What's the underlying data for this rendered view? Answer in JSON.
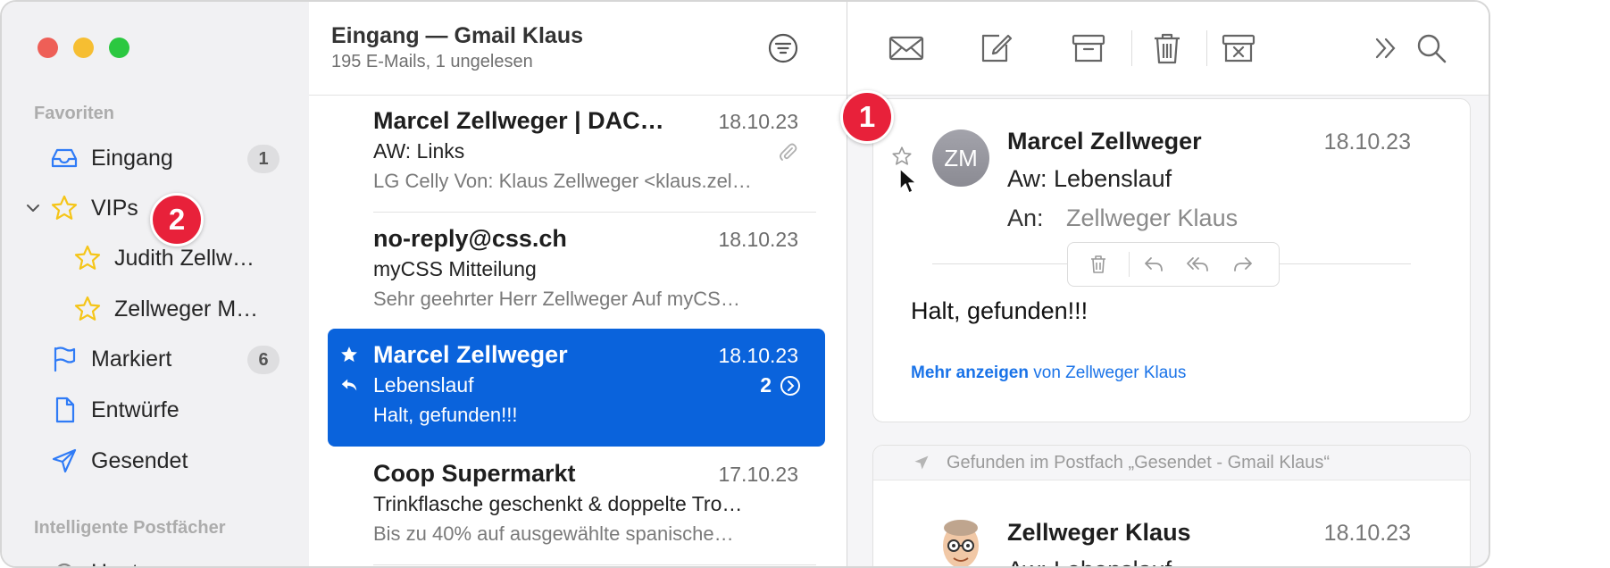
{
  "sidebar": {
    "sections": {
      "favorites": "Favoriten",
      "smart": "Intelligente Postfächer"
    },
    "items": [
      {
        "label": "Eingang",
        "count": "1",
        "icon": "tray-icon"
      },
      {
        "label": "VIPs",
        "icon": "star-icon"
      },
      {
        "label": "Judith Zellw…",
        "icon": "star-icon"
      },
      {
        "label": "Zellweger M…",
        "icon": "star-icon"
      },
      {
        "label": "Markiert",
        "count": "6",
        "icon": "flag-icon"
      },
      {
        "label": "Entwürfe",
        "icon": "document-icon"
      },
      {
        "label": "Gesendet",
        "icon": "paperplane-icon"
      },
      {
        "label": "Heute",
        "icon": "gear-icon"
      }
    ]
  },
  "list": {
    "title": "Eingang — Gmail Klaus",
    "subtitle": "195 E-Mails, 1 ungelesen",
    "messages": [
      {
        "sender": "Marcel Zellweger | DAC…",
        "date": "18.10.23",
        "subject": "AW: Links",
        "preview": "LG Celly Von: Klaus Zellweger <klaus.zel…"
      },
      {
        "sender": "no-reply@css.ch",
        "date": "18.10.23",
        "subject": "myCSS Mitteilung",
        "preview": "Sehr geehrter Herr Zellweger Auf myCS…"
      },
      {
        "sender": "Marcel Zellweger",
        "date": "18.10.23",
        "subject": "Lebenslauf",
        "preview": "Halt, gefunden!!!",
        "thread_count": "2"
      },
      {
        "sender": "Coop Supermarkt",
        "date": "17.10.23",
        "subject": "Trinkflasche geschenkt & doppelte Tro…",
        "preview": "Bis zu 40% auf ausgewählte spanische…"
      }
    ]
  },
  "reader": {
    "message": {
      "avatar_initials": "ZM",
      "sender": "Marcel Zellweger",
      "date": "18.10.23",
      "subject": "Aw: Lebenslauf",
      "to_label": "An:",
      "to": "Zellweger Klaus",
      "body": "Halt, gefunden!!!",
      "more_link": "Mehr anzeigen",
      "more_from": " von Zellweger Klaus"
    },
    "found_note": "Gefunden im Postfach „Gesendet - Gmail Klaus“",
    "message2": {
      "sender": "Zellweger Klaus",
      "date": "18.10.23",
      "subject": "Aw: Lebenslauf"
    }
  },
  "badges": {
    "one": "1",
    "two": "2"
  },
  "colors": {
    "accent": "#0a63dc",
    "badge": "#e8213a",
    "star": "#f5c518",
    "link": "#1a73e8"
  }
}
